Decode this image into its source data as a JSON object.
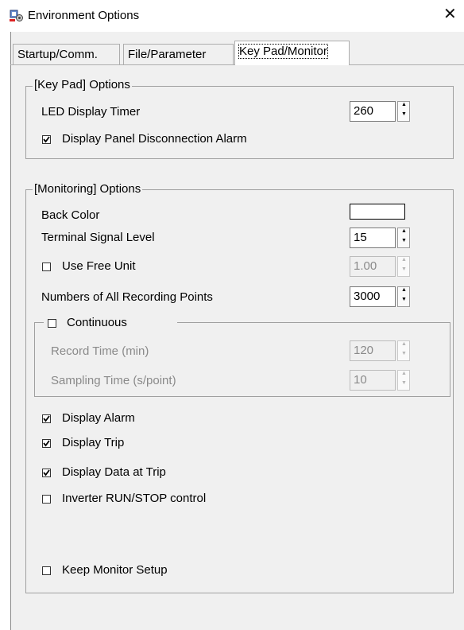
{
  "window": {
    "title": "Environment Options",
    "close_glyph": "✕",
    "icon": "app-settings-icon"
  },
  "tabs": [
    {
      "label": "Startup/Comm.",
      "active": false
    },
    {
      "label": "File/Parameter",
      "active": false
    },
    {
      "label": "Key Pad/Monitor",
      "active": true
    }
  ],
  "keypad": {
    "legend": "[Key Pad] Options",
    "led_timer_label": "LED Display Timer",
    "led_timer_value": "260",
    "disconnect_alarm_label": "Display Panel Disconnection Alarm",
    "disconnect_alarm_checked": true
  },
  "monitoring": {
    "legend": "[Monitoring] Options",
    "back_color_label": "Back Color",
    "back_color_value": "#ffffff",
    "terminal_level_label": "Terminal Signal Level",
    "terminal_level_value": "15",
    "free_unit_label": "Use Free Unit",
    "free_unit_checked": false,
    "free_unit_value": "1.00",
    "recording_points_label": "Numbers of All Recording Points",
    "recording_points_value": "3000",
    "continuous": {
      "label": "Continuous",
      "checked": false,
      "record_time_label": "Record Time (min)",
      "record_time_value": "120",
      "sampling_time_label": "Sampling Time (s/point)",
      "sampling_time_value": "10"
    },
    "display_alarm_label": "Display Alarm",
    "display_alarm_checked": true,
    "display_trip_label": "Display Trip",
    "display_trip_checked": true,
    "display_data_trip_label": "Display Data at Trip",
    "display_data_trip_checked": true,
    "inverter_control_label": "Inverter RUN/STOP control",
    "inverter_control_checked": false,
    "keep_setup_label": "Keep Monitor Setup",
    "keep_setup_checked": false
  },
  "colors": {
    "dialog_bg": "#f0f0f0",
    "disabled_text": "#8a8a8a"
  }
}
